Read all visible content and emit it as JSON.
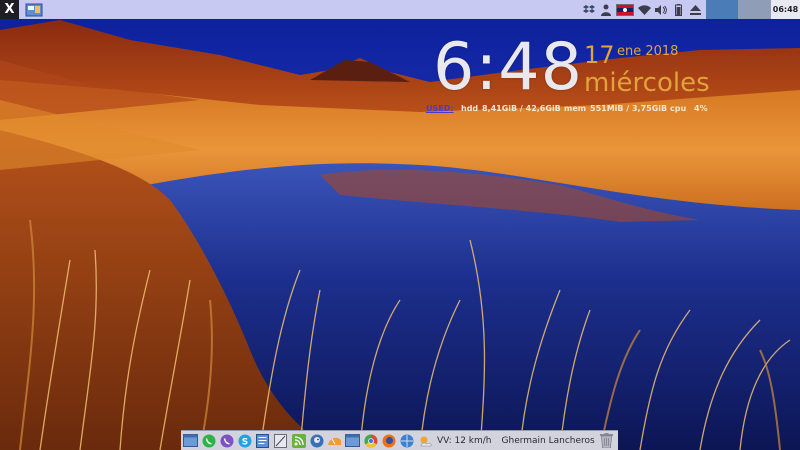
{
  "top_panel": {
    "menu_label": "X",
    "clock": "06:48",
    "colors": {
      "panel_bg": "#c8c9f2",
      "workspace_active": "#4a7cb8",
      "workspace_inactive": "#8f9eb6"
    },
    "tray": [
      "dropbox-icon",
      "user-icon",
      "keyboard-flag-icon",
      "wifi-icon",
      "volume-icon",
      "battery-icon",
      "eject-icon"
    ]
  },
  "conky": {
    "time": "6:48",
    "day": "17",
    "month_year": "ene 2018",
    "weekday": "miércoles",
    "used_label": "USED:",
    "hdd_label": "hdd",
    "hdd_value": "8,41GiB / 42,6GiB",
    "mem_label": "mem",
    "mem_value": "551MiB / 3,75GiB",
    "cpu_label": "cpu",
    "cpu_value": "4%",
    "colors": {
      "time": "#e8e8ee",
      "accent": "#e2a23c",
      "used": "#4a39d9"
    }
  },
  "dock": {
    "apps": [
      "file-manager-icon",
      "whatsapp-icon",
      "viber-icon",
      "skype-icon",
      "text-editor-icon",
      "calculator-icon",
      "rss-icon",
      "bird-icon",
      "cake-icon",
      "folder-icon",
      "chrome-icon",
      "firefox-icon",
      "network-icon",
      "weather-icon"
    ],
    "weather_text": "VV: 12 km/h",
    "user_name": "Ghermain Lancheros",
    "trash": "trash-icon"
  }
}
